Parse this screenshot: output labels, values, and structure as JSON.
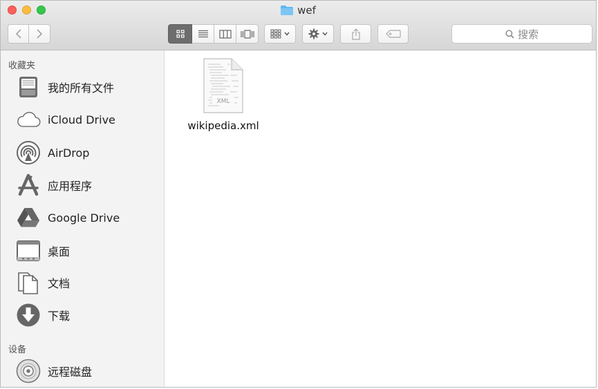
{
  "window": {
    "title": "wef"
  },
  "toolbar": {
    "search": {
      "placeholder": "搜索"
    }
  },
  "sidebar": {
    "favorites_header": "收藏夹",
    "favorites": [
      {
        "label": "我的所有文件",
        "icon": "all-files-icon"
      },
      {
        "label": "iCloud Drive",
        "icon": "icloud-icon"
      },
      {
        "label": "AirDrop",
        "icon": "airdrop-icon"
      },
      {
        "label": "应用程序",
        "icon": "applications-icon"
      },
      {
        "label": "Google Drive",
        "icon": "google-drive-icon"
      },
      {
        "label": "桌面",
        "icon": "desktop-icon"
      },
      {
        "label": "文档",
        "icon": "documents-icon"
      },
      {
        "label": "下载",
        "icon": "downloads-icon"
      }
    ],
    "devices_header": "设备",
    "devices": [
      {
        "label": "远程磁盘",
        "icon": "remote-disc-icon"
      }
    ]
  },
  "content": {
    "files": [
      {
        "name": "wikipedia.xml",
        "type_label": "XML"
      }
    ]
  }
}
